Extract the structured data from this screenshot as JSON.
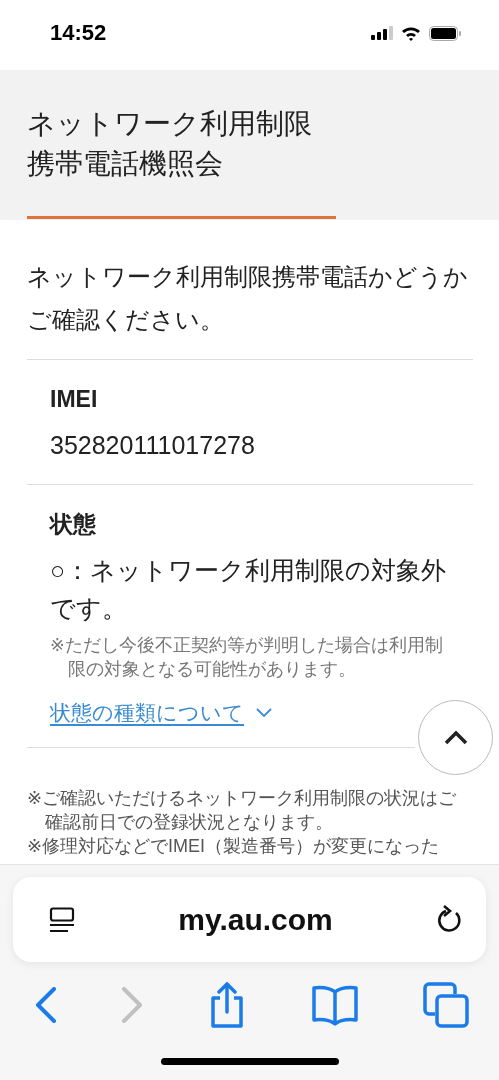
{
  "status_bar": {
    "time": "14:52"
  },
  "header": {
    "title_lines": [
      "ネットワーク利用制限",
      "携帯電話機照会"
    ]
  },
  "intro": "ネットワーク利用制限携帯電話かどうかご確認ください。",
  "sections": [
    {
      "label": "IMEI",
      "value": "352820111017278"
    },
    {
      "label": "状態",
      "value": "○：ネットワーク利用制限の対象外です。",
      "note": "※ただし今後不正契約等が判明した場合は利用制限の対象となる可能性があります。",
      "link": {
        "text": "状態の種類について",
        "expanded": false
      }
    }
  ],
  "footnotes": [
    "※ご確認いただけるネットワーク利用制限の状況はご確認前日での登録状況となります。",
    "※修理対応などでIMEI（製造番号）が変更になった"
  ],
  "browser": {
    "url": "my.au.com",
    "forward_disabled": true
  }
}
